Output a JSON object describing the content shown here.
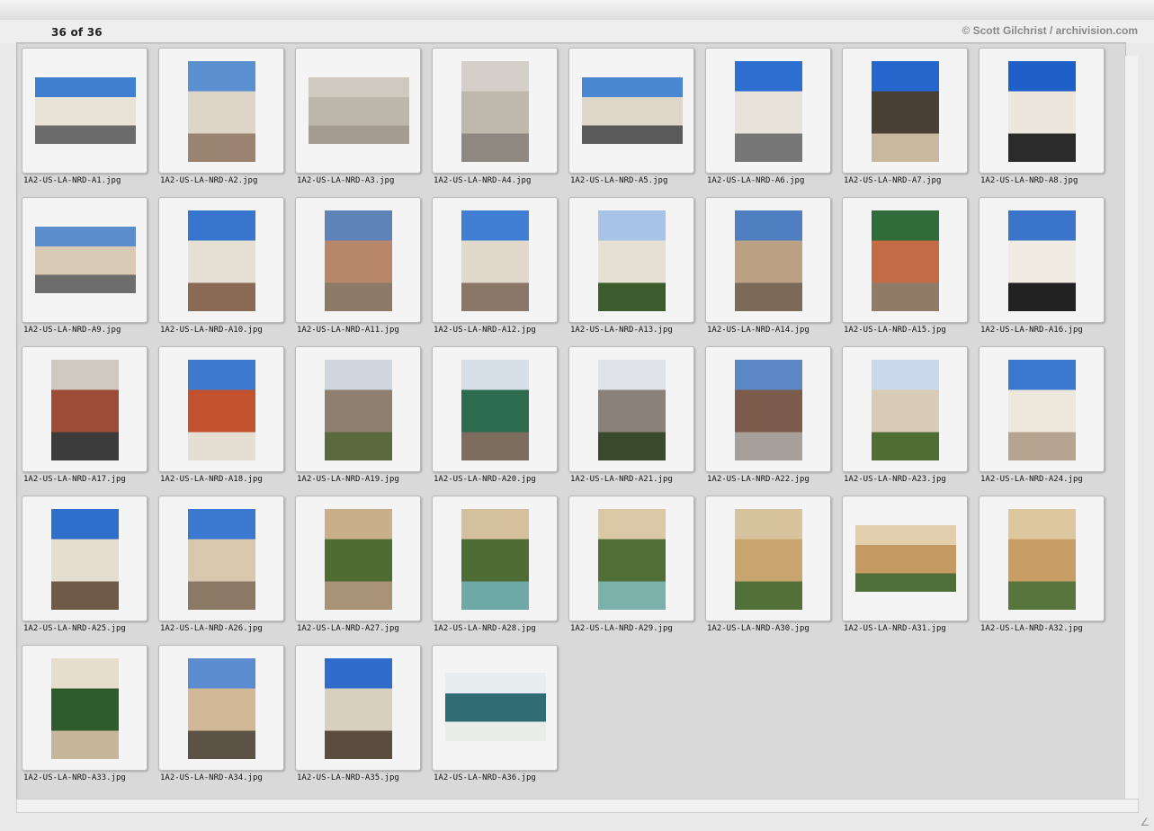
{
  "header": {
    "count": "36 of 36",
    "credit": "© Scott Gilchrist / archivision.com"
  },
  "thumbnails": [
    {
      "file": "1A2-US-LA-NRD-A1.jpg",
      "orient": "landscape",
      "colors": [
        "#3f7fd0",
        "#e9e2d6",
        "#6b6b6b"
      ]
    },
    {
      "file": "1A2-US-LA-NRD-A2.jpg",
      "orient": "portrait",
      "colors": [
        "#5a8fd0",
        "#ddd5c8",
        "#9a8370"
      ]
    },
    {
      "file": "1A2-US-LA-NRD-A3.jpg",
      "orient": "landscape",
      "colors": [
        "#cfc9c0",
        "#bdb6ab",
        "#a59d92"
      ]
    },
    {
      "file": "1A2-US-LA-NRD-A4.jpg",
      "orient": "portrait",
      "colors": [
        "#d4cfc8",
        "#bfb8ad",
        "#8f8880"
      ]
    },
    {
      "file": "1A2-US-LA-NRD-A5.jpg",
      "orient": "landscape",
      "colors": [
        "#4a86d2",
        "#ded6c8",
        "#5a5a5a"
      ]
    },
    {
      "file": "1A2-US-LA-NRD-A6.jpg",
      "orient": "portrait",
      "colors": [
        "#2c6fd1",
        "#e8e3da",
        "#777777"
      ]
    },
    {
      "file": "1A2-US-LA-NRD-A7.jpg",
      "orient": "portrait",
      "colors": [
        "#2466cc",
        "#4a3f35",
        "#c9b8a0"
      ]
    },
    {
      "file": "1A2-US-LA-NRD-A8.jpg",
      "orient": "portrait",
      "colors": [
        "#1f5fc8",
        "#ece6dc",
        "#2b2b2b"
      ]
    },
    {
      "file": "1A2-US-LA-NRD-A9.jpg",
      "orient": "landscape",
      "colors": [
        "#5b8ccb",
        "#d9cab5",
        "#6d6d6d"
      ]
    },
    {
      "file": "1A2-US-LA-NRD-A10.jpg",
      "orient": "portrait",
      "colors": [
        "#3676cf",
        "#e6dfd3",
        "#8a6a55"
      ]
    },
    {
      "file": "1A2-US-LA-NRD-A11.jpg",
      "orient": "portrait",
      "colors": [
        "#5d83b8",
        "#b8866a",
        "#8d7a66"
      ]
    },
    {
      "file": "1A2-US-LA-NRD-A12.jpg",
      "orient": "portrait",
      "colors": [
        "#3f7ed3",
        "#e1d9cc",
        "#8a7767"
      ]
    },
    {
      "file": "1A2-US-LA-NRD-A13.jpg",
      "orient": "portrait",
      "colors": [
        "#a7c4e6",
        "#e5dfd4",
        "#3d5c2e"
      ]
    },
    {
      "file": "1A2-US-LA-NRD-A14.jpg",
      "orient": "portrait",
      "colors": [
        "#4f7fc0",
        "#bca184",
        "#7b6a58"
      ]
    },
    {
      "file": "1A2-US-LA-NRD-A15.jpg",
      "orient": "portrait",
      "colors": [
        "#2f6c39",
        "#c46a45",
        "#8f7b66"
      ]
    },
    {
      "file": "1A2-US-LA-NRD-A16.jpg",
      "orient": "portrait",
      "colors": [
        "#3b74cb",
        "#f0ece4",
        "#222222"
      ]
    },
    {
      "file": "1A2-US-LA-NRD-A17.jpg",
      "orient": "portrait",
      "colors": [
        "#cfc9bf",
        "#9d4c38",
        "#3b3b3b"
      ]
    },
    {
      "file": "1A2-US-LA-NRD-A18.jpg",
      "orient": "portrait",
      "colors": [
        "#3e7ad0",
        "#c2522d",
        "#e5ded2"
      ]
    },
    {
      "file": "1A2-US-LA-NRD-A19.jpg",
      "orient": "portrait",
      "colors": [
        "#cfd6df",
        "#8e7f70",
        "#5a6a3e"
      ]
    },
    {
      "file": "1A2-US-LA-NRD-A20.jpg",
      "orient": "portrait",
      "colors": [
        "#d6dfe8",
        "#2d6b4f",
        "#7c6d5f"
      ]
    },
    {
      "file": "1A2-US-LA-NRD-A21.jpg",
      "orient": "portrait",
      "colors": [
        "#e0e4e8",
        "#8a8179",
        "#3a4a2c"
      ]
    },
    {
      "file": "1A2-US-LA-NRD-A22.jpg",
      "orient": "portrait",
      "colors": [
        "#5b87c4",
        "#7a5b4c",
        "#a7a09a"
      ]
    },
    {
      "file": "1A2-US-LA-NRD-A23.jpg",
      "orient": "portrait",
      "colors": [
        "#c9d8ea",
        "#d8cbb8",
        "#4f6e33"
      ]
    },
    {
      "file": "1A2-US-LA-NRD-A24.jpg",
      "orient": "portrait",
      "colors": [
        "#3a78cf",
        "#ede7dc",
        "#b5a48f"
      ]
    },
    {
      "file": "1A2-US-LA-NRD-A25.jpg",
      "orient": "portrait",
      "colors": [
        "#2f6fcc",
        "#e4ddd0",
        "#6f5a47"
      ]
    },
    {
      "file": "1A2-US-LA-NRD-A26.jpg",
      "orient": "portrait",
      "colors": [
        "#3b79d0",
        "#d8c8ae",
        "#8a7a65"
      ]
    },
    {
      "file": "1A2-US-LA-NRD-A27.jpg",
      "orient": "portrait",
      "colors": [
        "#c9b08a",
        "#4e6b32",
        "#a89376"
      ]
    },
    {
      "file": "1A2-US-LA-NRD-A28.jpg",
      "orient": "portrait",
      "colors": [
        "#d4c09d",
        "#4d6d34",
        "#6fa9a6"
      ]
    },
    {
      "file": "1A2-US-LA-NRD-A29.jpg",
      "orient": "portrait",
      "colors": [
        "#dbc8a6",
        "#4f6f37",
        "#7ab1ab"
      ]
    },
    {
      "file": "1A2-US-LA-NRD-A30.jpg",
      "orient": "portrait",
      "colors": [
        "#d7c49e",
        "#c9a66f",
        "#52703a"
      ]
    },
    {
      "file": "1A2-US-LA-NRD-A31.jpg",
      "orient": "landscape",
      "colors": [
        "#e3cfae",
        "#c49a62",
        "#4e6e3a"
      ]
    },
    {
      "file": "1A2-US-LA-NRD-A32.jpg",
      "orient": "portrait",
      "colors": [
        "#dcc79f",
        "#c89e66",
        "#57753d"
      ]
    },
    {
      "file": "1A2-US-LA-NRD-A33.jpg",
      "orient": "portrait",
      "colors": [
        "#e6ddca",
        "#2f5c2c",
        "#c7b79a"
      ]
    },
    {
      "file": "1A2-US-LA-NRD-A34.jpg",
      "orient": "portrait",
      "colors": [
        "#5b8ccf",
        "#d1b896",
        "#5d5246"
      ]
    },
    {
      "file": "1A2-US-LA-NRD-A35.jpg",
      "orient": "portrait",
      "colors": [
        "#2f6ccb",
        "#d9cfbe",
        "#5a4c3f"
      ]
    },
    {
      "file": "1A2-US-LA-NRD-A36.jpg",
      "orient": "wide",
      "colors": [
        "#e8eef0",
        "#2f6c74",
        "#e9efe8"
      ]
    }
  ]
}
